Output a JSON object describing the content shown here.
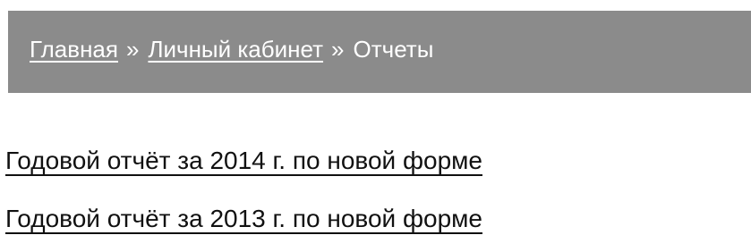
{
  "breadcrumb": {
    "items": [
      {
        "label": "Главная"
      },
      {
        "label": "Личный кабинет"
      }
    ],
    "separator": "»",
    "current": "Отчеты"
  },
  "reports": [
    {
      "label": "Годовой отчёт за 2014 г. по новой форме"
    },
    {
      "label": "Годовой отчёт за 2013 г. по новой форме"
    }
  ],
  "colors": {
    "breadcrumb_background": "#8b8b8b",
    "breadcrumb_text": "#ffffff",
    "link_text": "#111111",
    "page_background": "#ffffff"
  }
}
